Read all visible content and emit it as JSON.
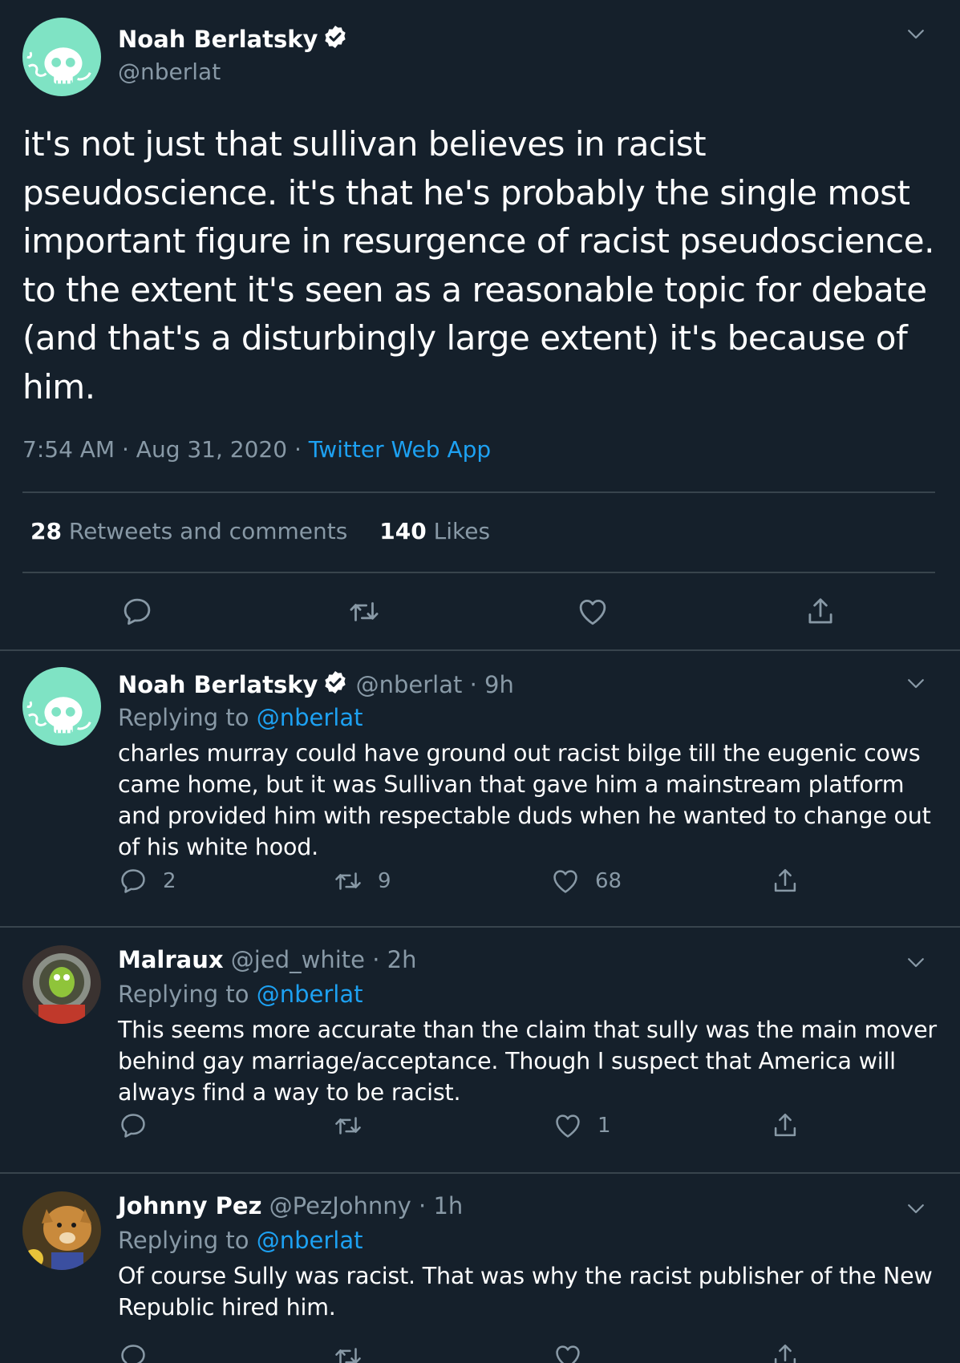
{
  "main_tweet": {
    "author_name": "Noah Berlatsky",
    "handle": "@nberlat",
    "text": "it's not just that sullivan believes in racist pseudoscience. it's that he's probably the single most important figure in resurgence of racist pseudoscience. to the extent it's seen as a reasonable topic for debate (and that's a disturbingly large extent) it's because of him.",
    "time": "7:54 AM · Aug 31, 2020 · ",
    "source": "Twitter Web App",
    "retweets_count": "28",
    "retweets_label": " Retweets and comments",
    "likes_count": "140",
    "likes_label": " Likes"
  },
  "replies": [
    {
      "author_name": "Noah Berlatsky",
      "handle_time": " @nberlat · 9h",
      "replying_prefix": "Replying to ",
      "replying_to": "@nberlat",
      "text": "charles murray could have ground out racist bilge till the eugenic cows came home, but it was Sullivan that gave him a mainstream platform and provided him with respectable duds when he wanted to change out of his white hood.",
      "reply_count": "2",
      "retweet_count": "9",
      "like_count": "68"
    },
    {
      "author_name": "Malraux",
      "handle_time": " @jed_white · 2h",
      "replying_prefix": "Replying to ",
      "replying_to": "@nberlat",
      "text": "This seems more accurate than the claim that sully was the main mover behind gay marriage/acceptance. Though I suspect that America will always find a way to be racist.",
      "reply_count": "",
      "retweet_count": "",
      "like_count": "1"
    },
    {
      "author_name": "Johnny Pez",
      "handle_time": " @PezJohnny · 1h",
      "replying_prefix": "Replying to ",
      "replying_to": "@nberlat",
      "text": "Of course Sully was racist. That was why the racist publisher of the New Republic hired him.",
      "reply_count": "",
      "retweet_count": "",
      "like_count": ""
    }
  ],
  "colors": {
    "background": "#15202b",
    "secondary_text": "#8899a6",
    "link": "#1da1f2",
    "divider": "#38444d"
  },
  "icons": [
    "verified-badge-icon",
    "chevron-down-icon",
    "reply-icon",
    "retweet-icon",
    "like-icon",
    "share-icon"
  ]
}
